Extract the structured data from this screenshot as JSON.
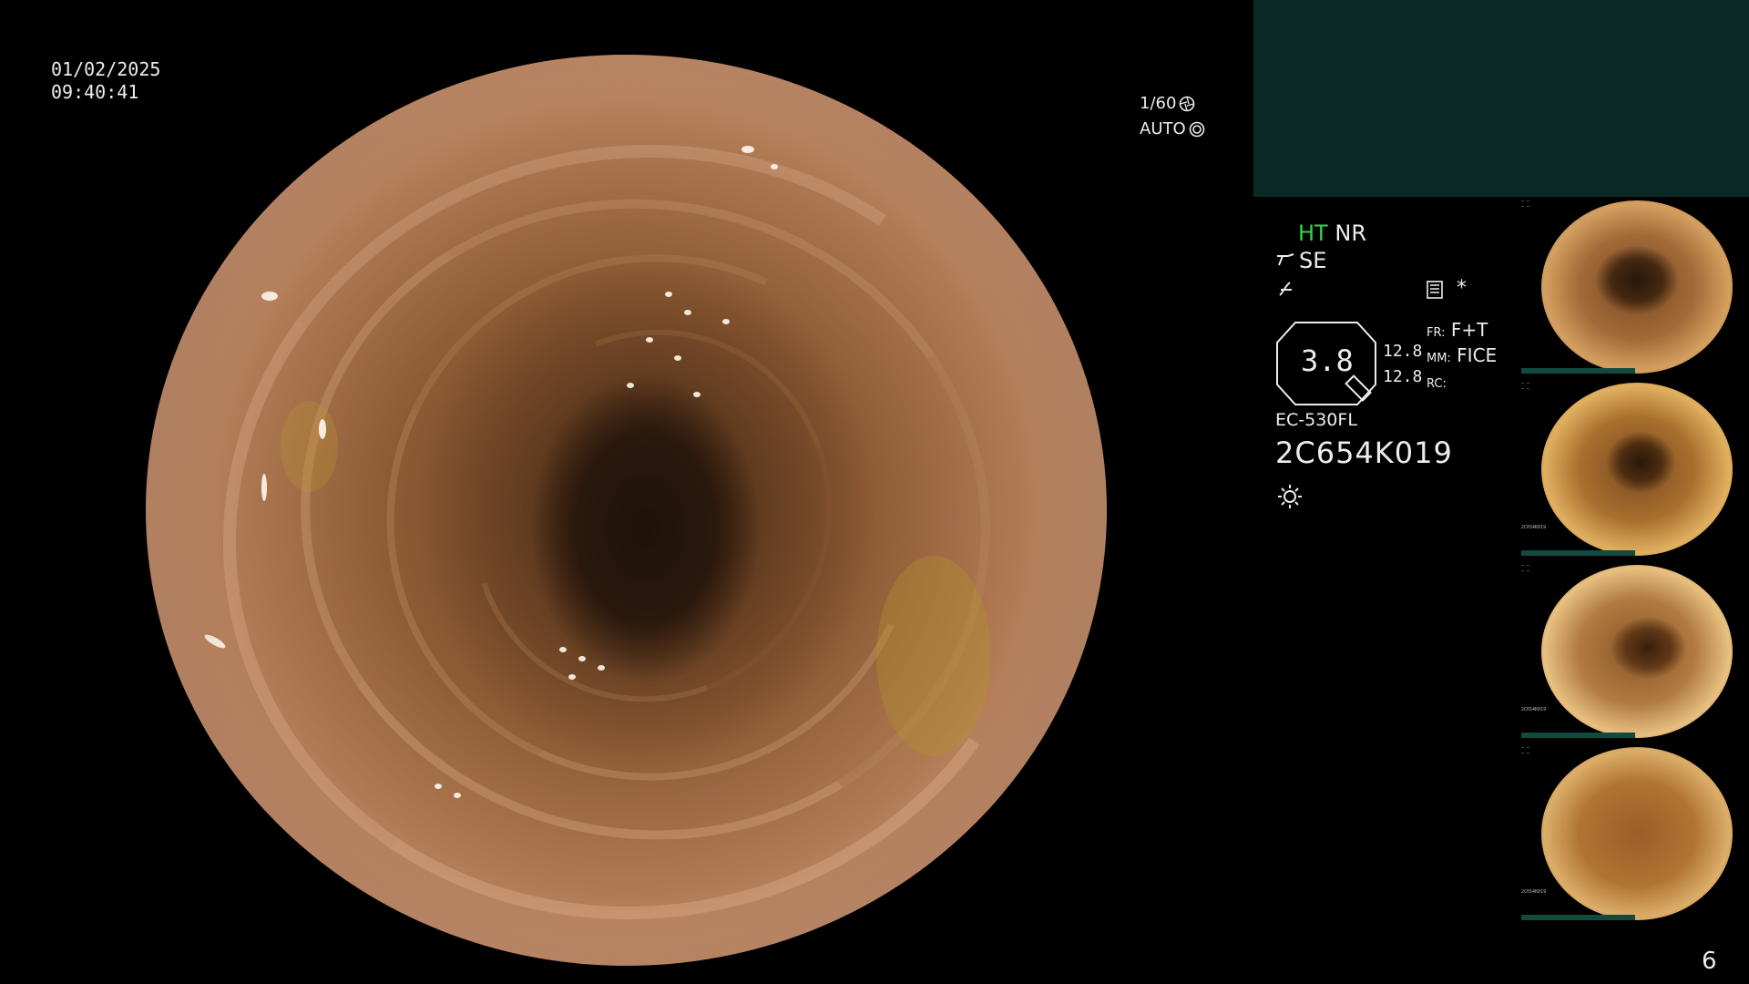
{
  "overlay": {
    "date": "01/02/2025",
    "time": "09:40:41",
    "shutter": "1/60",
    "shutter_icon": "aperture-icon",
    "iris_mode": "AUTO",
    "iris_icon": "iris-icon"
  },
  "settings": {
    "ht_label": "HT",
    "nr_label": "NR",
    "se_label": "SE",
    "zoom_value": "3.8",
    "value_a": "12.8",
    "value_b": "12.8",
    "fr_label": "FR:",
    "fr_value": "F+T",
    "mm_label": "MM:",
    "mm_value": "FICE",
    "rc_label": "RC:",
    "scope_model": "EC-530FL",
    "serial_number": "2C654K019"
  },
  "thumbnails": {
    "count": 4,
    "serial_caption": "2C654K019"
  },
  "page_number": "6",
  "colors": {
    "background": "#000000",
    "accent_green": "#3ad24a",
    "panel_teal": "#0c2a25",
    "text": "#ececec"
  }
}
